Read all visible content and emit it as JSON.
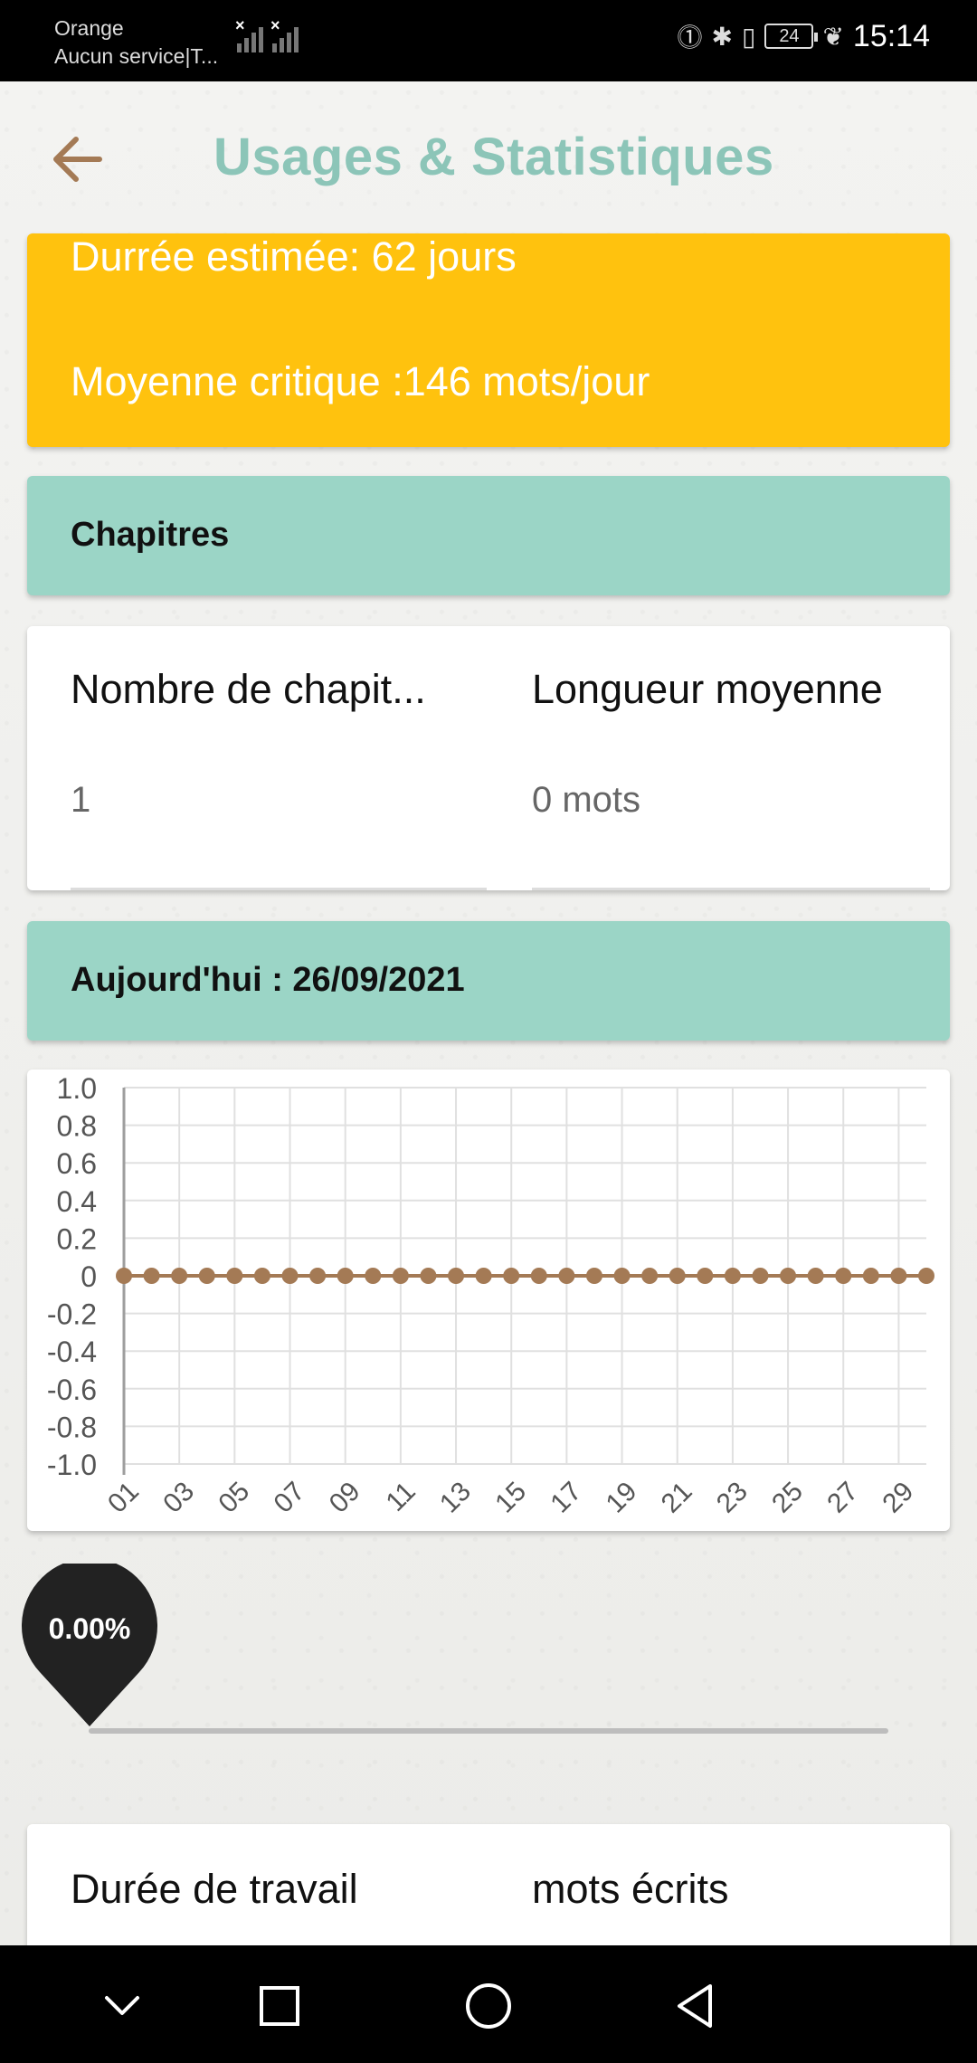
{
  "status_bar": {
    "carrier": "Orange",
    "network": "Aucun service|T...",
    "battery": "24",
    "time": "15:14"
  },
  "header": {
    "title": "Usages & Statistiques",
    "back_icon": "arrow-left-icon"
  },
  "summary": {
    "duration": "Durrée estimée: 62 jours",
    "average": "Moyenne critique :146 mots/jour"
  },
  "chapters": {
    "section_title": "Chapitres",
    "count_label": "Nombre de chapit...",
    "count_value": "1",
    "avg_label": "Longueur moyenne",
    "avg_value": "0 mots"
  },
  "today": {
    "section_title": "Aujourd'hui : 26/09/2021"
  },
  "progress": {
    "label": "0.00%",
    "value": 0.0
  },
  "work": {
    "duration_label": "Durée de travail",
    "words_label": "mots écrits"
  },
  "colors": {
    "accent_teal": "#9bd5c6",
    "title_teal": "#8cc5b8",
    "yellow": "#ffc20e",
    "point": "#a47a55",
    "back_arrow": "#a47a55"
  },
  "chart_data": {
    "type": "line",
    "x": [
      "01",
      "02",
      "03",
      "04",
      "05",
      "06",
      "07",
      "08",
      "09",
      "10",
      "11",
      "12",
      "13",
      "14",
      "15",
      "16",
      "17",
      "18",
      "19",
      "20",
      "21",
      "22",
      "23",
      "24",
      "25",
      "26",
      "27",
      "28",
      "29",
      "30"
    ],
    "x_tick_labels": [
      "01",
      "03",
      "05",
      "07",
      "09",
      "11",
      "13",
      "15",
      "17",
      "19",
      "21",
      "23",
      "25",
      "27",
      "29"
    ],
    "values": [
      0,
      0,
      0,
      0,
      0,
      0,
      0,
      0,
      0,
      0,
      0,
      0,
      0,
      0,
      0,
      0,
      0,
      0,
      0,
      0,
      0,
      0,
      0,
      0,
      0,
      0,
      0,
      0,
      0,
      0
    ],
    "y_tick_labels": [
      "1.0",
      "0.8",
      "0.6",
      "0.4",
      "0.2",
      "0",
      "-0.2",
      "-0.4",
      "-0.6",
      "-0.8",
      "-1.0"
    ],
    "y_ticks": [
      1.0,
      0.8,
      0.6,
      0.4,
      0.2,
      0,
      -0.2,
      -0.4,
      -0.6,
      -0.8,
      -1.0
    ],
    "ylim": [
      -1.0,
      1.0
    ],
    "grid": true,
    "color": "#a47a55"
  }
}
